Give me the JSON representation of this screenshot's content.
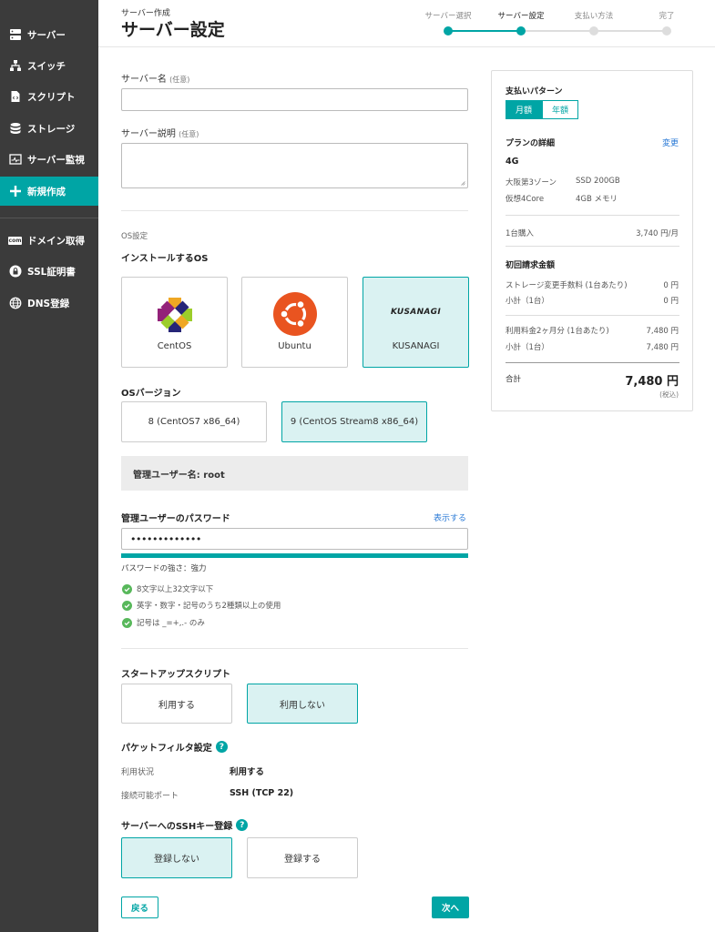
{
  "sidebar": {
    "items": [
      {
        "label": "サーバー",
        "icon": "server-icon"
      },
      {
        "label": "スイッチ",
        "icon": "switch-icon"
      },
      {
        "label": "スクリプト",
        "icon": "script-icon"
      },
      {
        "label": "ストレージ",
        "icon": "storage-icon"
      },
      {
        "label": "サーバー監視",
        "icon": "monitor-icon"
      },
      {
        "label": "新規作成",
        "icon": "plus-icon"
      },
      {
        "label": "ドメイン取得",
        "icon": "com-icon"
      },
      {
        "label": "SSL証明書",
        "icon": "lock-icon"
      },
      {
        "label": "DNS登録",
        "icon": "globe-icon"
      }
    ],
    "com_icon_text": "com"
  },
  "header": {
    "breadcrumb": "サーバー作成",
    "title": "サーバー設定",
    "steps": [
      "サーバー選択",
      "サーバー設定",
      "支払い方法",
      "完了"
    ]
  },
  "form": {
    "server_name_label": "サーバー名",
    "server_name_optional": "(任意)",
    "server_name_value": "",
    "server_desc_label": "サーバー説明",
    "server_desc_optional": "(任意)",
    "server_desc_value": "",
    "os_section": "OS設定",
    "install_os_label": "インストールするOS",
    "os_options": [
      {
        "name": "CentOS",
        "selected": false
      },
      {
        "name": "Ubuntu",
        "selected": false
      },
      {
        "name": "KUSANAGI",
        "selected": true
      }
    ],
    "kusanagi_logo": "KUSANAGI",
    "os_version_label": "OSバージョン",
    "os_versions": [
      {
        "label": "8 (CentOS7 x86_64)",
        "selected": false
      },
      {
        "label": "9 (CentOS Stream8 x86_64)",
        "selected": true
      }
    ],
    "admin_user": "管理ユーザー名: root",
    "password_label": "管理ユーザーのパスワード",
    "show_password": "表示する",
    "password_value": "•••••••••••••",
    "strength_text": "パスワードの強さ：強力",
    "strength_fraction": 1.0,
    "rules": [
      "8文字以上32文字以下",
      "英字・数字・記号のうち2種類以上の使用",
      "記号は _=+,.- のみ"
    ],
    "startup_script_label": "スタートアップスクリプト",
    "startup_options": [
      {
        "label": "利用する",
        "selected": false
      },
      {
        "label": "利用しない",
        "selected": true
      }
    ],
    "packet_filter_label": "パケットフィルタ設定",
    "usage_label": "利用状況",
    "usage_value": "利用する",
    "port_label": "接続可能ポート",
    "port_value": "SSH (TCP 22)",
    "ssh_key_label": "サーバーへのSSHキー登録",
    "ssh_options": [
      {
        "label": "登録しない",
        "selected": true
      },
      {
        "label": "登録する",
        "selected": false
      }
    ],
    "help_glyph": "?",
    "back_button": "戻る",
    "next_button": "次へ"
  },
  "summary": {
    "pay_pattern_label": "支払いパターン",
    "pay_monthly": "月額",
    "pay_yearly": "年額",
    "plan_detail_label": "プランの詳細",
    "change_link": "変更",
    "plan_name": "4G",
    "zone": "大阪第3ゾーン",
    "disk": "SSD 200GB",
    "cpu": "仮想4Core",
    "memory": "4GB メモリ",
    "unit_label": "1台購入",
    "unit_price": "3,740 円/月",
    "initial_label": "初回請求金額",
    "storage_fee_label": "ストレージ変更手数料 (1台あたり)",
    "storage_fee_value": "0 円",
    "subtotal1_label": "小計（1台）",
    "subtotal1_value": "0 円",
    "usage_fee_label": "利用料金2ヶ月分 (1台あたり)",
    "usage_fee_value": "7,480 円",
    "subtotal2_label": "小計（1台）",
    "subtotal2_value": "7,480 円",
    "total_label": "合計",
    "total_value": "7,480 円",
    "tax_note": "(税込)"
  },
  "colors": {
    "accent": "#00a5a5",
    "sidebar_bg": "#3b3b3b",
    "selected_bg": "#daf2f2"
  }
}
